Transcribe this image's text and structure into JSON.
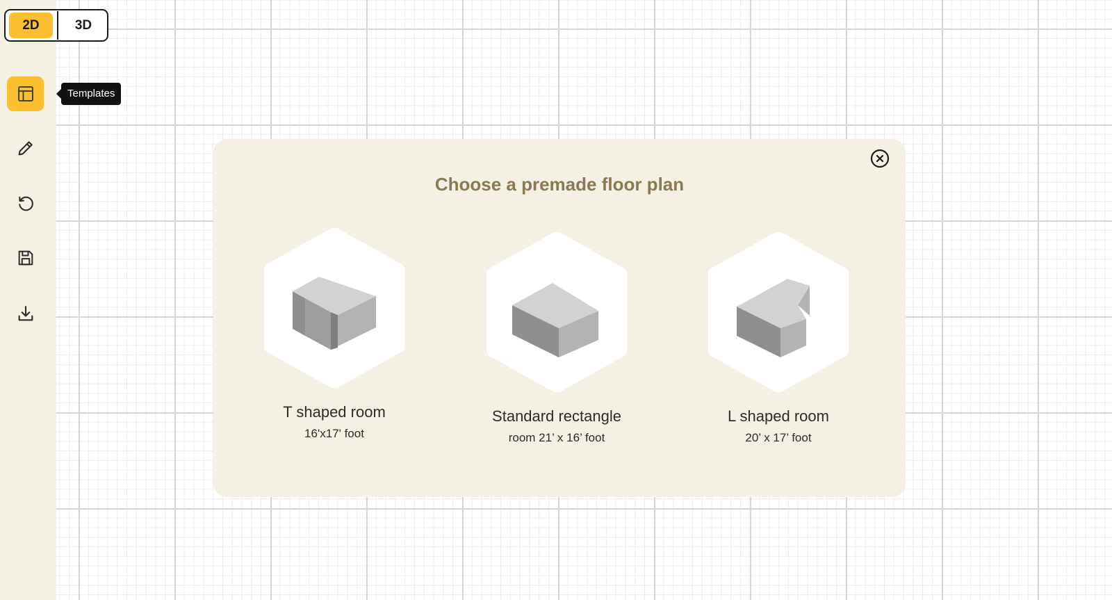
{
  "view_toggle": {
    "option_2d": "2D",
    "option_3d": "3D",
    "selected": "2D"
  },
  "sidebar": {
    "tools": [
      {
        "icon": "template-icon",
        "label": "Templates",
        "active": true
      },
      {
        "icon": "pencil-icon",
        "active": false
      },
      {
        "icon": "undo-icon",
        "active": false
      },
      {
        "icon": "save-icon",
        "active": false
      },
      {
        "icon": "download-icon",
        "active": false
      }
    ],
    "tooltip": "Templates"
  },
  "modal": {
    "title": "Choose a premade floor plan",
    "close_icon": "close-circle-icon",
    "templates": [
      {
        "name": "T shaped room",
        "size": "16'x17' foot",
        "icon": "t-shaped-room-icon"
      },
      {
        "name": "Standard rectangle",
        "size": "room 21’ x 16’ foot",
        "icon": "rectangle-room-icon"
      },
      {
        "name": "L shaped room",
        "size": "20’ x 17’ foot",
        "icon": "l-shaped-room-icon"
      }
    ]
  },
  "colors": {
    "accent": "#fbbf30",
    "panel_bg": "#f5f0e4",
    "title": "#8a7a53",
    "tooltip_bg": "#111111",
    "block_top": "#d2d2d2",
    "block_right": "#b3b3b3",
    "block_left": "#8f8f8f"
  }
}
